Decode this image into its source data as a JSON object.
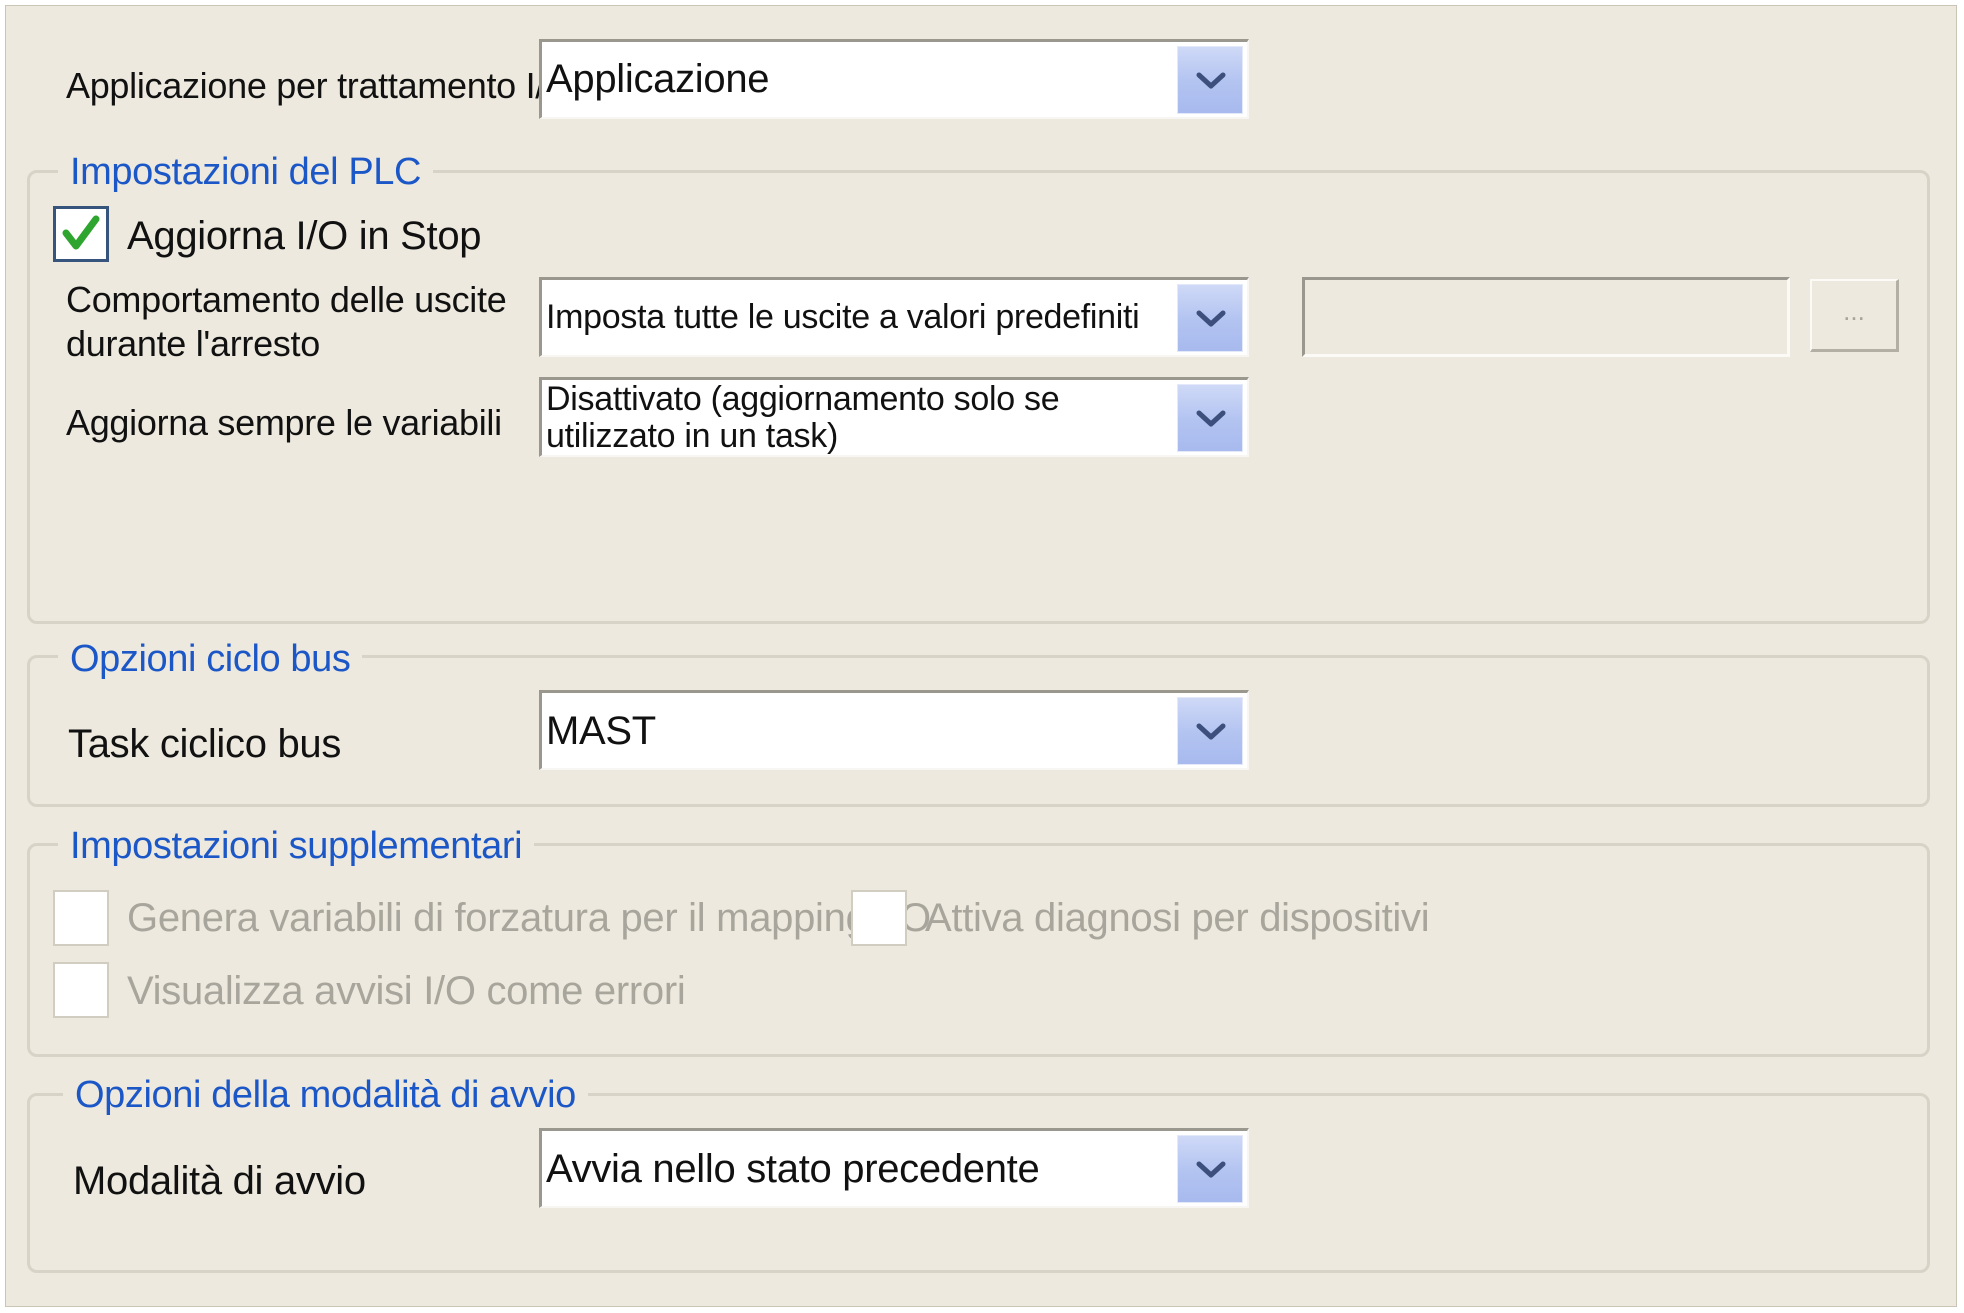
{
  "io_application": {
    "label": "Applicazione per trattamento I/O:",
    "value": "Applicazione"
  },
  "plc_settings": {
    "title": "Impostazioni del PLC",
    "update_io_in_stop": {
      "label": "Aggiorna I/O in Stop",
      "checked": true
    },
    "outputs_behavior": {
      "label_line1": "Comportamento delle uscite",
      "label_line2": "durante l'arresto",
      "value": "Imposta tutte le uscite a valori predefiniti",
      "text_value": "",
      "browse_label": "..."
    },
    "always_update_variables": {
      "label": "Aggiorna sempre le variabili",
      "value_line1": "Disattivato (aggiornamento solo se",
      "value_line2": "utilizzato in un task)"
    }
  },
  "bus_cycle": {
    "title": "Opzioni ciclo bus",
    "task_label": "Task ciclico bus",
    "task_value": "MAST"
  },
  "additional_settings": {
    "title": "Impostazioni supplementari",
    "force_variables": {
      "label": "Genera variabili di forzatura per il mapping I/O",
      "checked": false
    },
    "device_diagnosis": {
      "label": "Attiva diagnosi per dispositivi",
      "checked": false
    },
    "warnings_as_errors": {
      "label": "Visualizza avvisi I/O come errori",
      "checked": false
    }
  },
  "startup_mode": {
    "title": "Opzioni della modalità di avvio",
    "label": "Modalità di avvio",
    "value": "Avvia nello stato precedente"
  },
  "colors": {
    "panel_bg": "#ede9de",
    "legend_text": "#1c57c8",
    "disabled_text": "#a8a59c",
    "check_green": "#2ea52e",
    "dropdown_button": "#b2c3f1"
  }
}
